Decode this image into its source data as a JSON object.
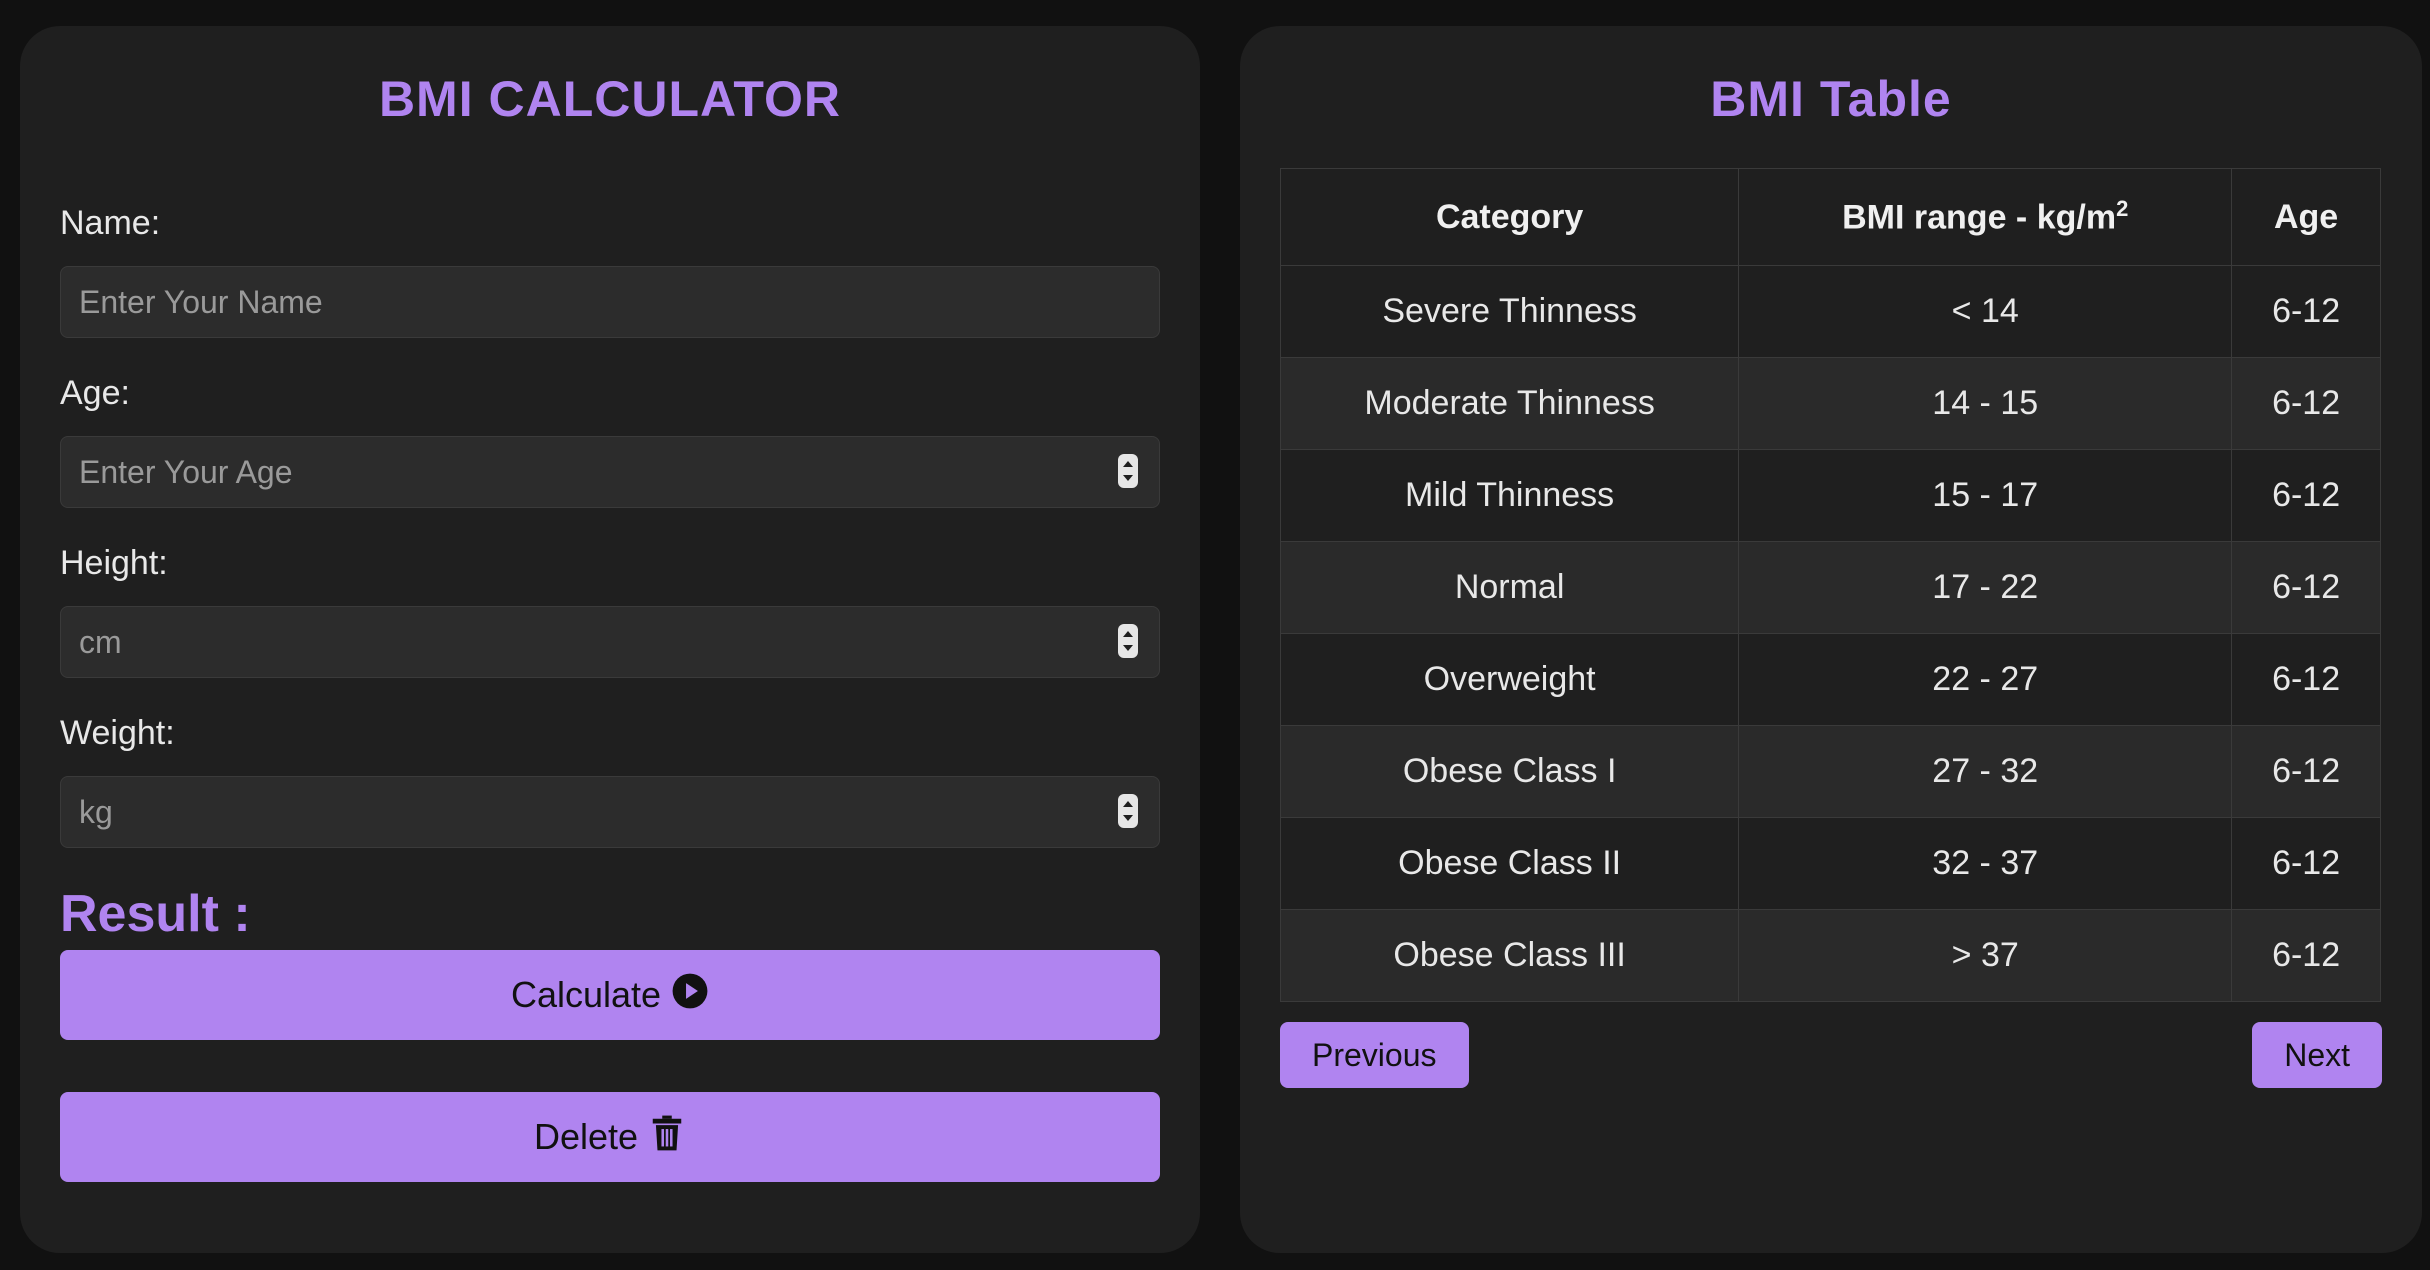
{
  "calculator": {
    "title": "BMI CALCULATOR",
    "name_label": "Name:",
    "name_placeholder": "Enter Your Name",
    "age_label": "Age:",
    "age_placeholder": "Enter Your Age",
    "height_label": "Height:",
    "height_placeholder": "cm",
    "weight_label": "Weight:",
    "weight_placeholder": "kg",
    "result_label": "Result :",
    "calculate_label": "Calculate",
    "delete_label": "Delete"
  },
  "table": {
    "title": "BMI Table",
    "headers": {
      "category": "Category",
      "range": "BMI range - kg/m",
      "range_sup": "2",
      "age": "Age"
    },
    "rows": [
      {
        "category": "Severe Thinness",
        "range": "< 14",
        "age": "6-12"
      },
      {
        "category": "Moderate Thinness",
        "range": "14 - 15",
        "age": "6-12"
      },
      {
        "category": "Mild Thinness",
        "range": "15 - 17",
        "age": "6-12"
      },
      {
        "category": "Normal",
        "range": "17 - 22",
        "age": "6-12"
      },
      {
        "category": "Overweight",
        "range": "22 - 27",
        "age": "6-12"
      },
      {
        "category": "Obese Class I",
        "range": "27 - 32",
        "age": "6-12"
      },
      {
        "category": "Obese Class II",
        "range": "32 - 37",
        "age": "6-12"
      },
      {
        "category": "Obese Class III",
        "range": "> 37",
        "age": "6-12"
      }
    ],
    "previous_label": "Previous",
    "next_label": "Next"
  },
  "colors": {
    "accent": "#b084f0",
    "panel": "#1f1f1f",
    "background": "#111111"
  },
  "icons": {
    "calculate": "play-circle-icon",
    "delete": "trash-icon",
    "spinner": "spinner-icon"
  }
}
